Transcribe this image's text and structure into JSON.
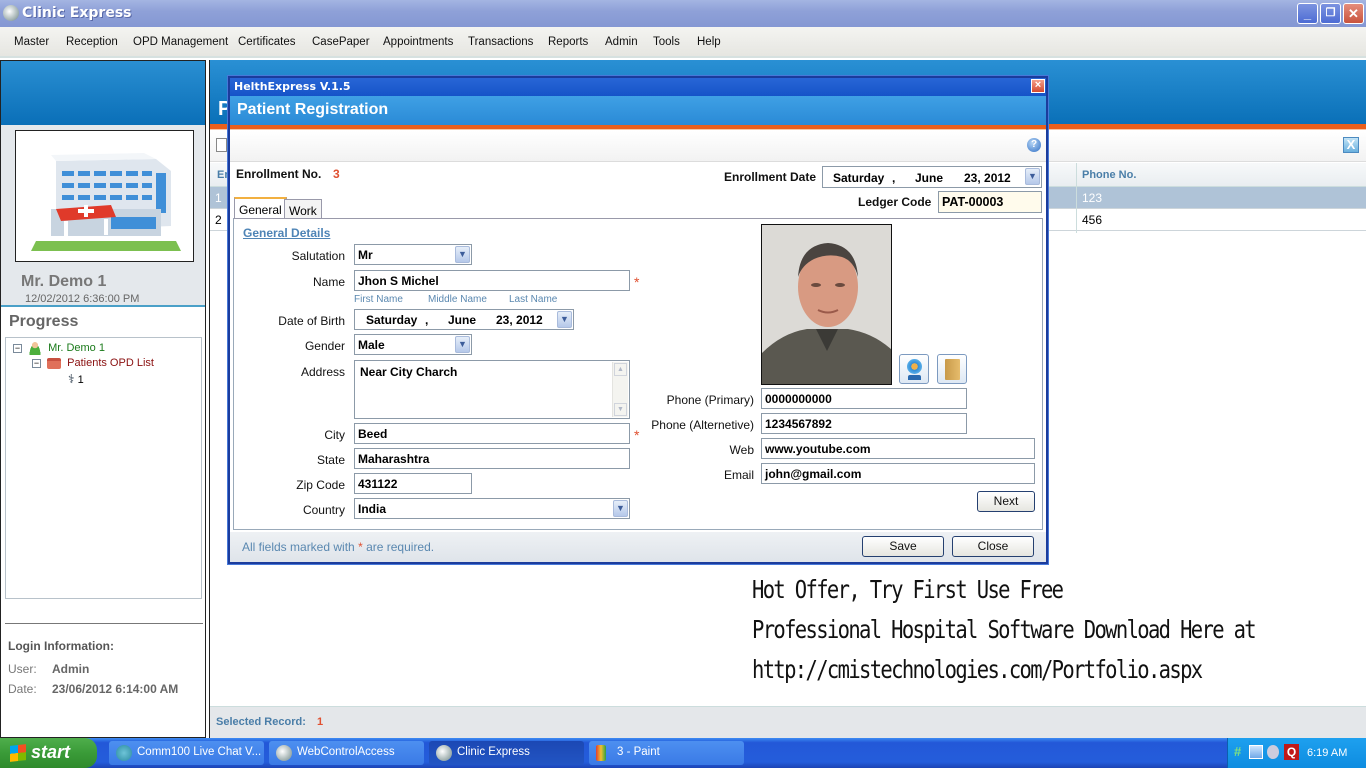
{
  "window": {
    "title": "Clinic Express",
    "controls": {
      "minimize": "_",
      "restore": "❐",
      "close": "✕"
    }
  },
  "menu": [
    "Master",
    "Reception",
    "OPD Management",
    "Certificates",
    "CasePaper",
    "Appointments",
    "Transactions",
    "Reports",
    "Admin",
    "Tools",
    "Help"
  ],
  "sidebar": {
    "patient_name": "Mr. Demo 1",
    "patient_datetime": "12/02/2012 6:36:00 PM",
    "progress_title": "Progress",
    "tree": [
      {
        "label": "Mr. Demo 1",
        "icon": "user-icon",
        "color": "#1a7a1a"
      },
      {
        "label": "Patients OPD List",
        "icon": "briefcase-icon",
        "color": "#8a1010"
      },
      {
        "label": "1",
        "icon": "stethoscope-icon",
        "color": "#111"
      }
    ],
    "login": {
      "title": "Login Information:",
      "user_label": "User:",
      "user_value": "Admin",
      "date_label": "Date:",
      "date_value": "23/06/2012 6:14:00 AM"
    }
  },
  "background_list": {
    "title_initial": "P",
    "first_col_header": "En",
    "phone_header": "Phone No.",
    "rows": [
      {
        "no": "1",
        "phone": "123",
        "selected": true
      },
      {
        "no": "2",
        "phone": "456",
        "selected": false
      }
    ],
    "status_label": "Selected Record:",
    "status_value": "1"
  },
  "dialog": {
    "window_title": "HelthExpress V.1.5",
    "header_title": "Patient Registration",
    "enrollment_no_label": "Enrollment No.",
    "enrollment_no_value": "3",
    "enrollment_date_label": "Enrollment Date",
    "enrollment_date": {
      "day": "Saturday",
      "sep": ",",
      "month": "June",
      "date": "23, 2012"
    },
    "ledger_code_label": "Ledger Code",
    "ledger_code_value": "PAT-00003",
    "tabs": [
      "General",
      "Work"
    ],
    "active_tab": "General",
    "section_title": "General Details",
    "fields": {
      "salutation": {
        "label": "Salutation",
        "value": "Mr"
      },
      "name": {
        "label": "Name",
        "value": "Jhon S Michel",
        "required": true
      },
      "name_hints": [
        "First Name",
        "Middle Name",
        "Last Name"
      ],
      "dob": {
        "label": "Date of Birth",
        "day": "Saturday",
        "sep": ",",
        "month": "June",
        "date": "23, 2012"
      },
      "gender": {
        "label": "Gender",
        "value": "Male"
      },
      "address": {
        "label": "Address",
        "value": "Near City Charch"
      },
      "city": {
        "label": "City",
        "value": "Beed",
        "required": true
      },
      "state": {
        "label": "State",
        "value": "Maharashtra"
      },
      "zip": {
        "label": "Zip Code",
        "value": "431122"
      },
      "country": {
        "label": "Country",
        "value": "India"
      },
      "phone_primary": {
        "label": "Phone (Primary)",
        "value": "0000000000"
      },
      "phone_alt": {
        "label": "Phone (Alternetive)",
        "value": "1234567892"
      },
      "web": {
        "label": "Web",
        "value": "www.youtube.com"
      },
      "email": {
        "label": "Email",
        "value": "john@gmail.com"
      }
    },
    "required_marker": "*",
    "buttons": {
      "next": "Next",
      "save": "Save",
      "close": "Close"
    },
    "footer_note_prefix": "All fields marked with",
    "footer_note_suffix": "are required.",
    "help_glyph": "?"
  },
  "promo": [
    "Hot Offer,  Try First Use Free",
    "Professional Hospital Software Download Here at",
    "http://cmistechnologies.com/Portfolio.aspx"
  ],
  "taskbar": {
    "start_label": "start",
    "tasks": [
      {
        "label": "Comm100 Live Chat V...",
        "active": false
      },
      {
        "label": "WebControlAccess",
        "active": false
      },
      {
        "label": "Clinic Express",
        "active": true
      },
      {
        "label": "3 - Paint",
        "active": false
      }
    ],
    "clock": "6:19 AM"
  }
}
